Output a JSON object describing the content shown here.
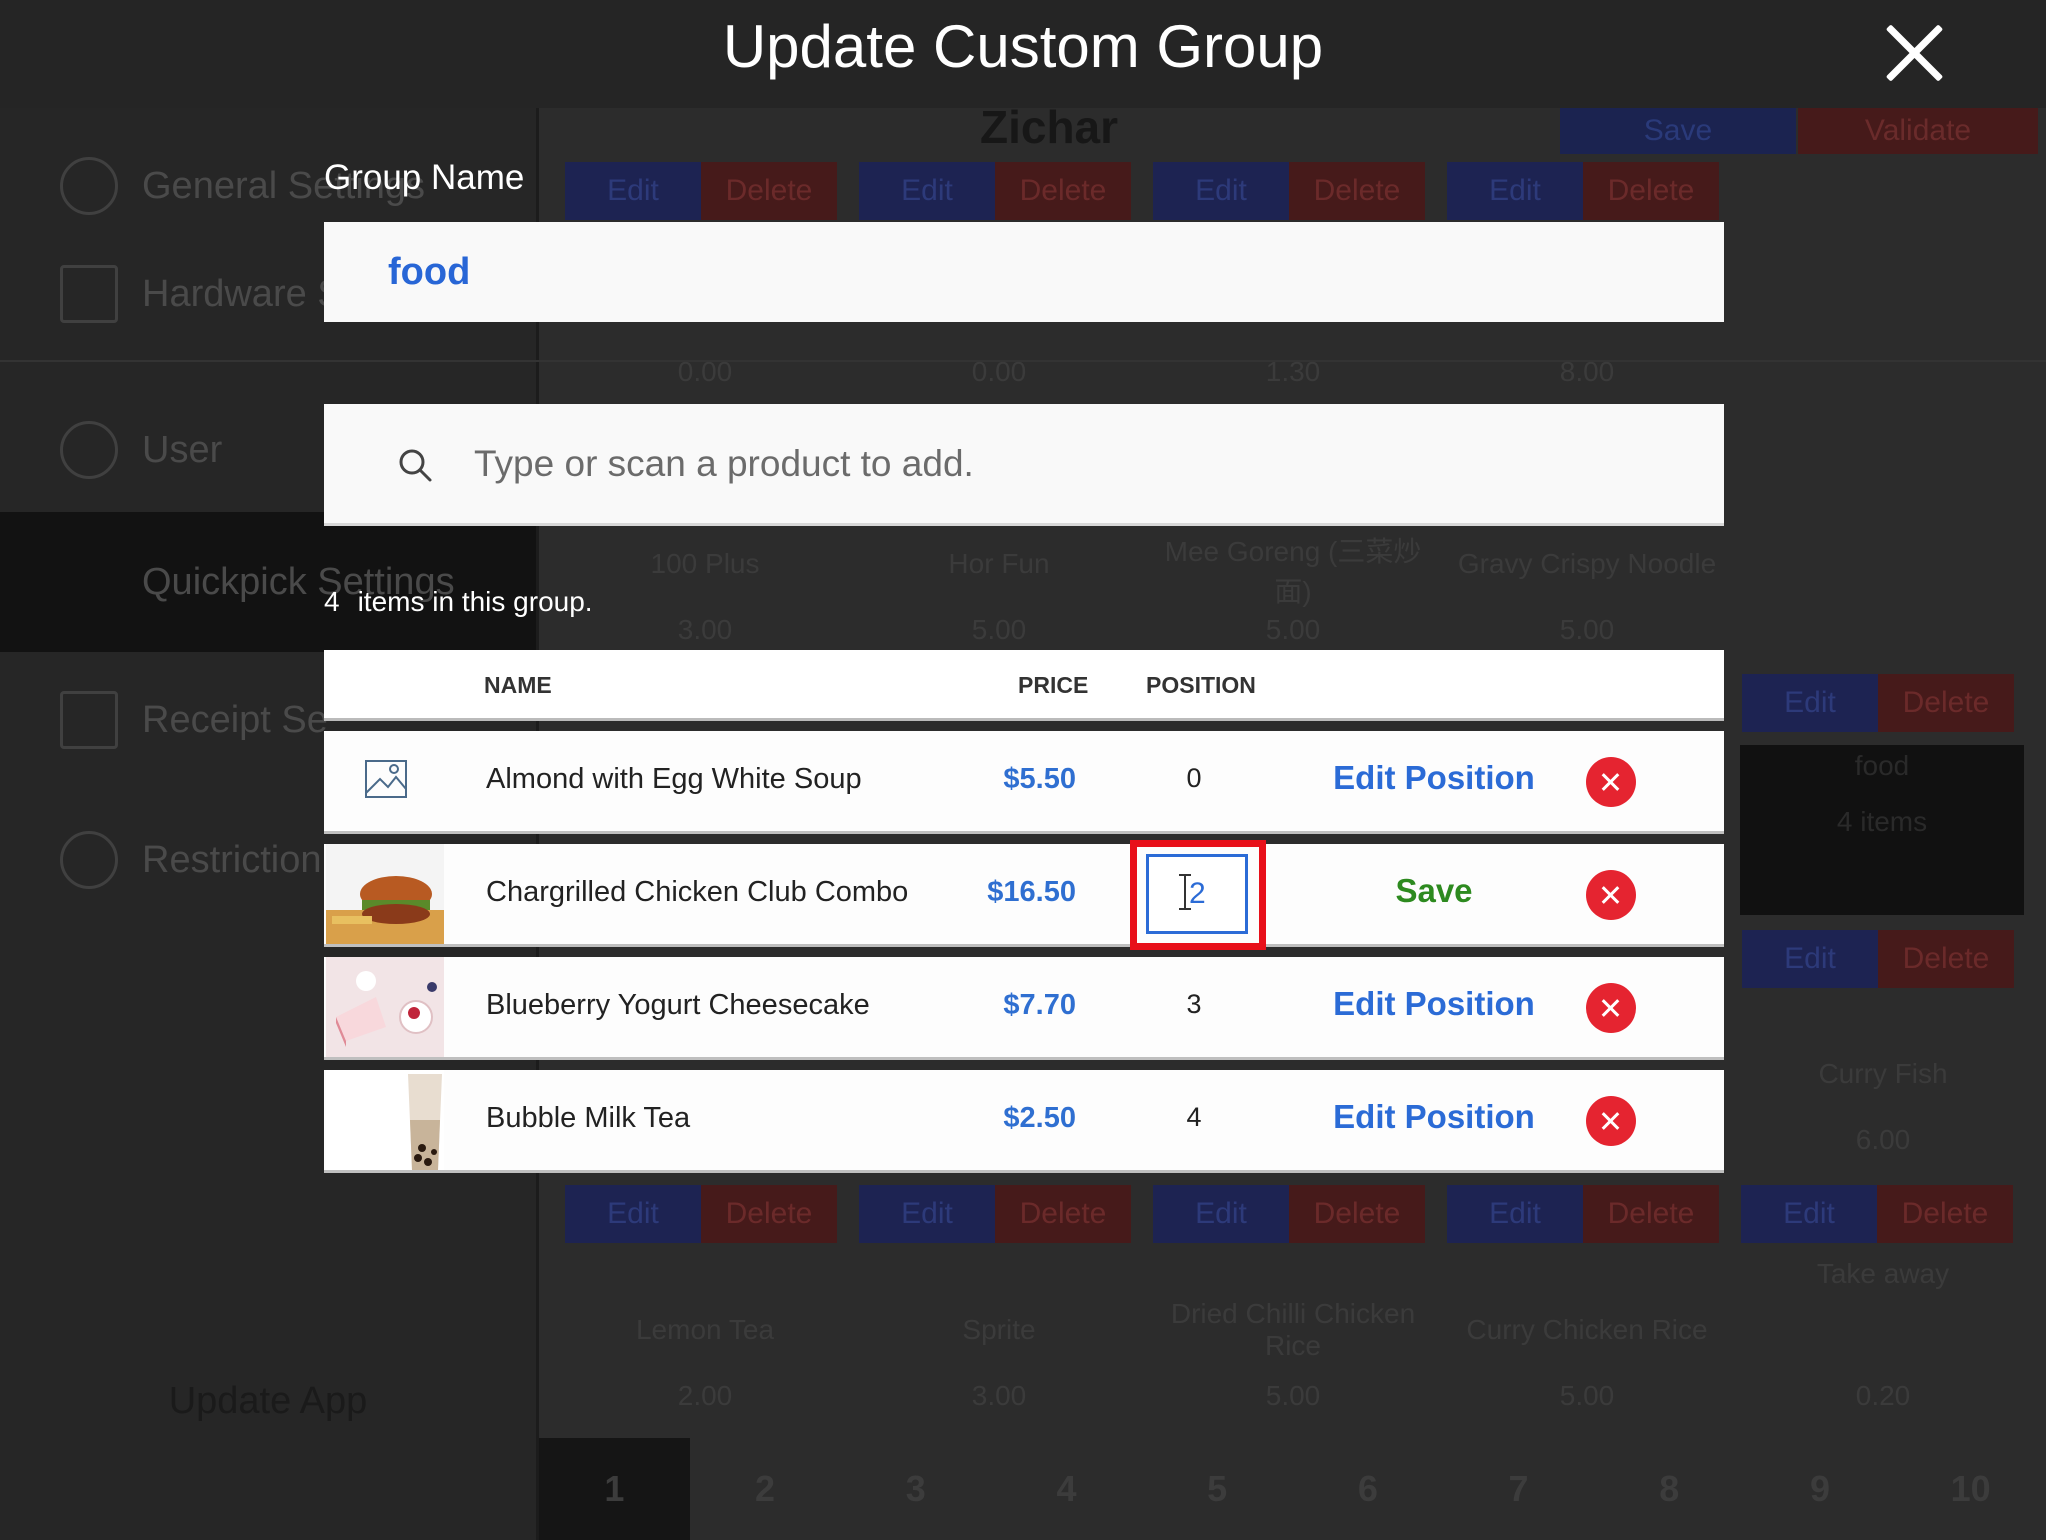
{
  "modal": {
    "title": "Update Custom Group",
    "group_name_label": "Group Name",
    "group_name_value": "food",
    "search_placeholder": "Type or scan a product to add.",
    "items_count": "4",
    "items_count_text": "items in this group.",
    "columns": {
      "name": "NAME",
      "price": "PRICE",
      "position": "POSITION"
    },
    "rows": [
      {
        "name": "Almond with Egg White Soup",
        "price": "$5.50",
        "position": "0",
        "action": "Edit Position"
      },
      {
        "name": "Chargrilled Chicken Club Combo",
        "price": "$16.50",
        "position": "2",
        "action": "Save"
      },
      {
        "name": "Blueberry Yogurt Cheesecake",
        "price": "$7.70",
        "position": "3",
        "action": "Edit Position"
      },
      {
        "name": "Bubble Milk Tea",
        "price": "$2.50",
        "position": "4",
        "action": "Edit Position"
      }
    ]
  },
  "background": {
    "sidebar": [
      "General Settings",
      "Hardware S",
      "User",
      "Quickpick Settings",
      "Receipt Se",
      "Restriction"
    ],
    "update_app": "Update App",
    "title": "Zichar",
    "save": "Save",
    "validate": "Validate",
    "edit": "Edit",
    "delete": "Delete",
    "prices_row1": [
      "0.00",
      "0.00",
      "1.30",
      "8.00"
    ],
    "products_row2": [
      "100 Plus",
      "Hor Fun",
      "Mee Goreng (三菜炒面)",
      "Gravy Crispy Noodle"
    ],
    "prices_row2": [
      "3.00",
      "5.00",
      "5.00",
      "5.00"
    ],
    "food_tile": {
      "name": "food",
      "count": "4 items"
    },
    "curry_fish": {
      "name": "Curry Fish",
      "price": "6.00"
    },
    "products_row3": [
      "Lemon Tea",
      "Sprite",
      "Dried Chilli Chicken Rice",
      "Curry Chicken Rice",
      "Take away"
    ],
    "prices_row3": [
      "2.00",
      "3.00",
      "5.00",
      "5.00",
      "0.20"
    ],
    "pages": [
      "1",
      "2",
      "3",
      "4",
      "5",
      "6",
      "7",
      "8",
      "9",
      "10"
    ]
  },
  "colors": {
    "accent_blue": "#2b6bd6",
    "save_green": "#2d8a1f",
    "remove_red": "#e52430",
    "highlight_red": "#e8101a"
  },
  "icons": {
    "close": "close-icon",
    "search": "search-icon",
    "remove": "remove-icon",
    "placeholder_image": "image-placeholder-icon"
  }
}
